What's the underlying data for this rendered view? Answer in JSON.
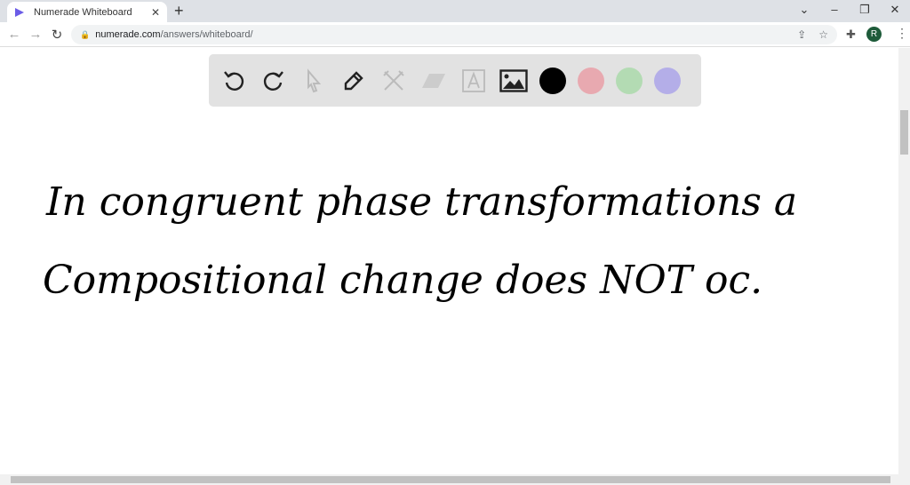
{
  "browser": {
    "tab_title": "Numerade Whiteboard",
    "url_host": "numerade.com",
    "url_path": "/answers/whiteboard/",
    "profile_initial": "R"
  },
  "toolbar": {
    "tools": [
      "undo-icon",
      "redo-icon",
      "select-icon",
      "pen-icon",
      "tools-icon",
      "eraser-icon",
      "text-icon",
      "image-icon"
    ],
    "colors": [
      "#000000",
      "#e8a9b0",
      "#b3dbb3",
      "#b4aee8"
    ]
  },
  "board": {
    "line1": "In congruent phase transformations  a",
    "line2": "Compositional change does NOT oc."
  }
}
